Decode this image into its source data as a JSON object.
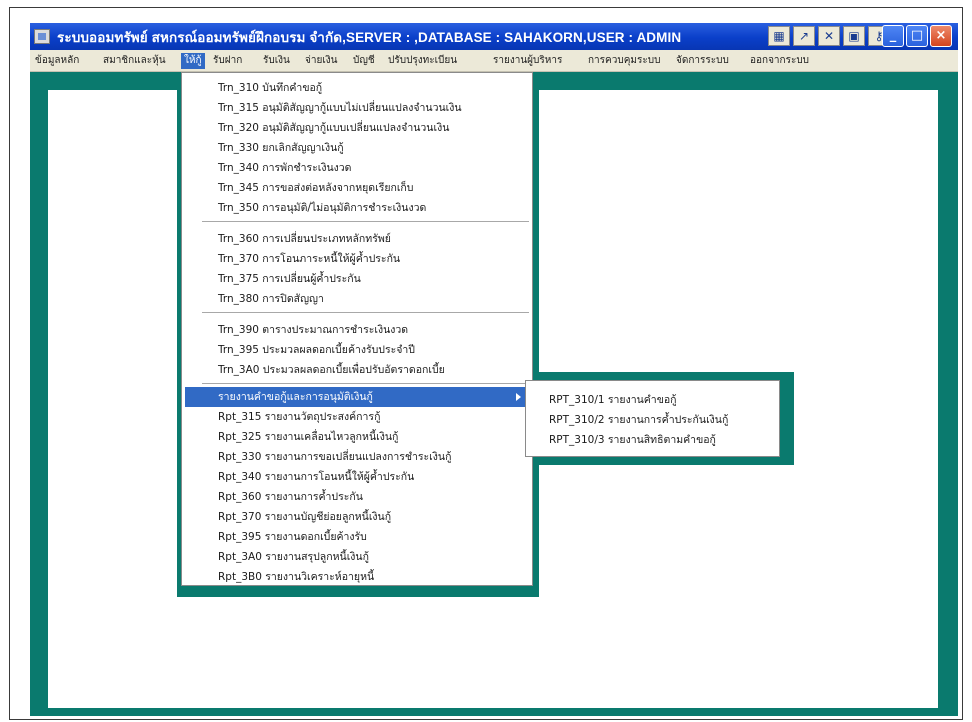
{
  "window": {
    "title": "ระบบออมทรัพย์ สหกรณ์ออมทรัพย์ฝึกอบรม จำกัด,SERVER : ,DATABASE : SAHAKORN,USER : ADMIN",
    "tool_icons": [
      "grid-icon",
      "chart-icon",
      "excel-icon",
      "image-icon",
      "key-icon"
    ],
    "controls": {
      "minimize": "_",
      "maximize": "□",
      "close": "×"
    }
  },
  "menubar": {
    "items": [
      "ข้อมูลหลัก",
      "สมาชิกและหุ้น",
      "ให้กู้",
      "รับฝาก",
      "รับเงิน",
      "จ่ายเงิน",
      "บัญชี",
      "ปรับปรุงทะเบียน",
      "รายงานผู้บริหาร",
      "การควบคุมระบบ",
      "จัดการระบบ",
      "ออกจากระบบ"
    ],
    "active_index": 2
  },
  "dropdown": {
    "groups": [
      [
        "Trn_310 บันทึกคำขอกู้",
        "Trn_315 อนุมัติสัญญากู้แบบไม่เปลี่ยนแปลงจำนวนเงิน",
        "Trn_320 อนุมัติสัญญากู้แบบเปลี่ยนแปลงจำนวนเงิน",
        "Trn_330 ยกเลิกสัญญาเงินกู้",
        "Trn_340 การพักชำระเงินงวด",
        "Trn_345 การขอส่งต่อหลังจากหยุดเรียกเก็บ",
        "Trn_350 การอนุมัติ/ไม่อนุมัติการชำระเงินงวด"
      ],
      [
        "Trn_360 การเปลี่ยนประเภทหลักทรัพย์",
        "Trn_370 การโอนภาระหนี้ให้ผู้ค้ำประกัน",
        "Trn_375 การเปลี่ยนผู้ค้ำประกัน",
        "Trn_380 การปิดสัญญา"
      ],
      [
        "Trn_390 ตารางประมาณการชำระเงินงวด",
        "Trn_395 ประมวลผลดอกเบี้ยค้างรับประจำปี",
        "Trn_3A0 ประมวลผลดอกเบี้ยเพื่อปรับอัตราดอกเบี้ย"
      ],
      [
        "รายงานคำขอกู้และการอนุมัติเงินกู้",
        "Rpt_315 รายงานวัตถุประสงค์การกู้",
        "Rpt_325 รายงานเคลื่อนไหวลูกหนี้เงินกู้",
        "Rpt_330 รายงานการขอเปลี่ยนแปลงการชำระเงินกู้",
        "Rpt_340 รายงานการโอนหนี้ให้ผู้ค้ำประกัน",
        "Rpt_360 รายงานการค้ำประกัน",
        "Rpt_370 รายงานบัญชีย่อยลูกหนี้เงินกู้",
        "Rpt_395 รายงานดอกเบี้ยค้างรับ",
        "Rpt_3A0 รายงานสรุปลูกหนี้เงินกู้",
        "Rpt_3B0 รายงานวิเคราะห์อายุหนี้"
      ]
    ],
    "highlight": "รายงานคำขอกู้และการอนุมัติเงินกู้"
  },
  "submenu": {
    "items": [
      "RPT_310/1 รายงานคำขอกู้",
      "RPT_310/2 รายงานการค้ำประกันเงินกู้",
      "RPT_310/3 รายงานสิทธิตามคำขอกู้"
    ]
  }
}
